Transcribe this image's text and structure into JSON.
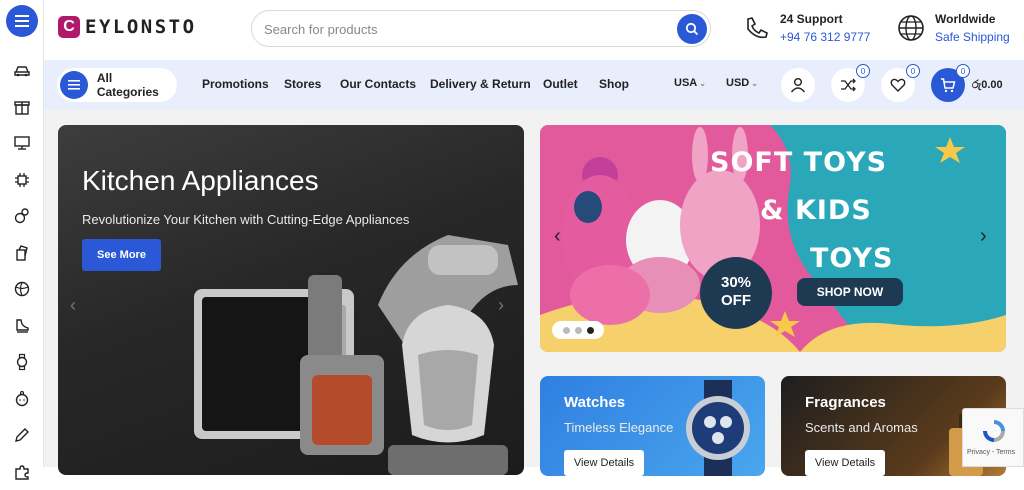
{
  "brand": {
    "logo_letter": "C",
    "name": "EYLONSTO",
    "color": "#b01a6a"
  },
  "accent_color": "#2b58d6",
  "search": {
    "placeholder": "Search for products"
  },
  "support": {
    "title": "24 Support",
    "phone": "+94 76 312 9777"
  },
  "shipping": {
    "title": "Worldwide",
    "subtitle": "Safe Shipping"
  },
  "nav": {
    "all_categories": "All Categories",
    "items": [
      "Promotions",
      "Stores",
      "Our Contacts",
      "Delivery & Return",
      "Outlet",
      "Shop"
    ],
    "country": "USA",
    "currency": "USD",
    "compare_count": "0",
    "wishlist_count": "0",
    "cart_count": "0",
    "cart_total": "රු0.00"
  },
  "sidebar": {
    "icons": [
      "car-icon",
      "gift-box-icon",
      "monitor-icon",
      "chip-icon",
      "toys-icon",
      "grocery-icon",
      "sports-ball-icon",
      "shoe-icon",
      "watch-icon",
      "baby-icon",
      "pencil-icon",
      "puzzle-icon"
    ]
  },
  "hero": {
    "title": "Kitchen Appliances",
    "subtitle": "Revolutionize Your Kitchen with Cutting-Edge Appliances",
    "button": "See More"
  },
  "promo": {
    "line1": "SOFT TOYS",
    "line2": "& KIDS",
    "line3": "TOYS",
    "discount_line1": "30%",
    "discount_line2": "OFF",
    "cta": "SHOP NOW",
    "active_slide": 3,
    "slides": 3
  },
  "tiles": [
    {
      "title": "Watches",
      "subtitle": "Timeless Elegance",
      "button": "View Details"
    },
    {
      "title": "Fragrances",
      "subtitle": "Scents and Aromas",
      "button": "View Details"
    }
  ],
  "recaptcha": {
    "text": "Privacy - Terms"
  }
}
